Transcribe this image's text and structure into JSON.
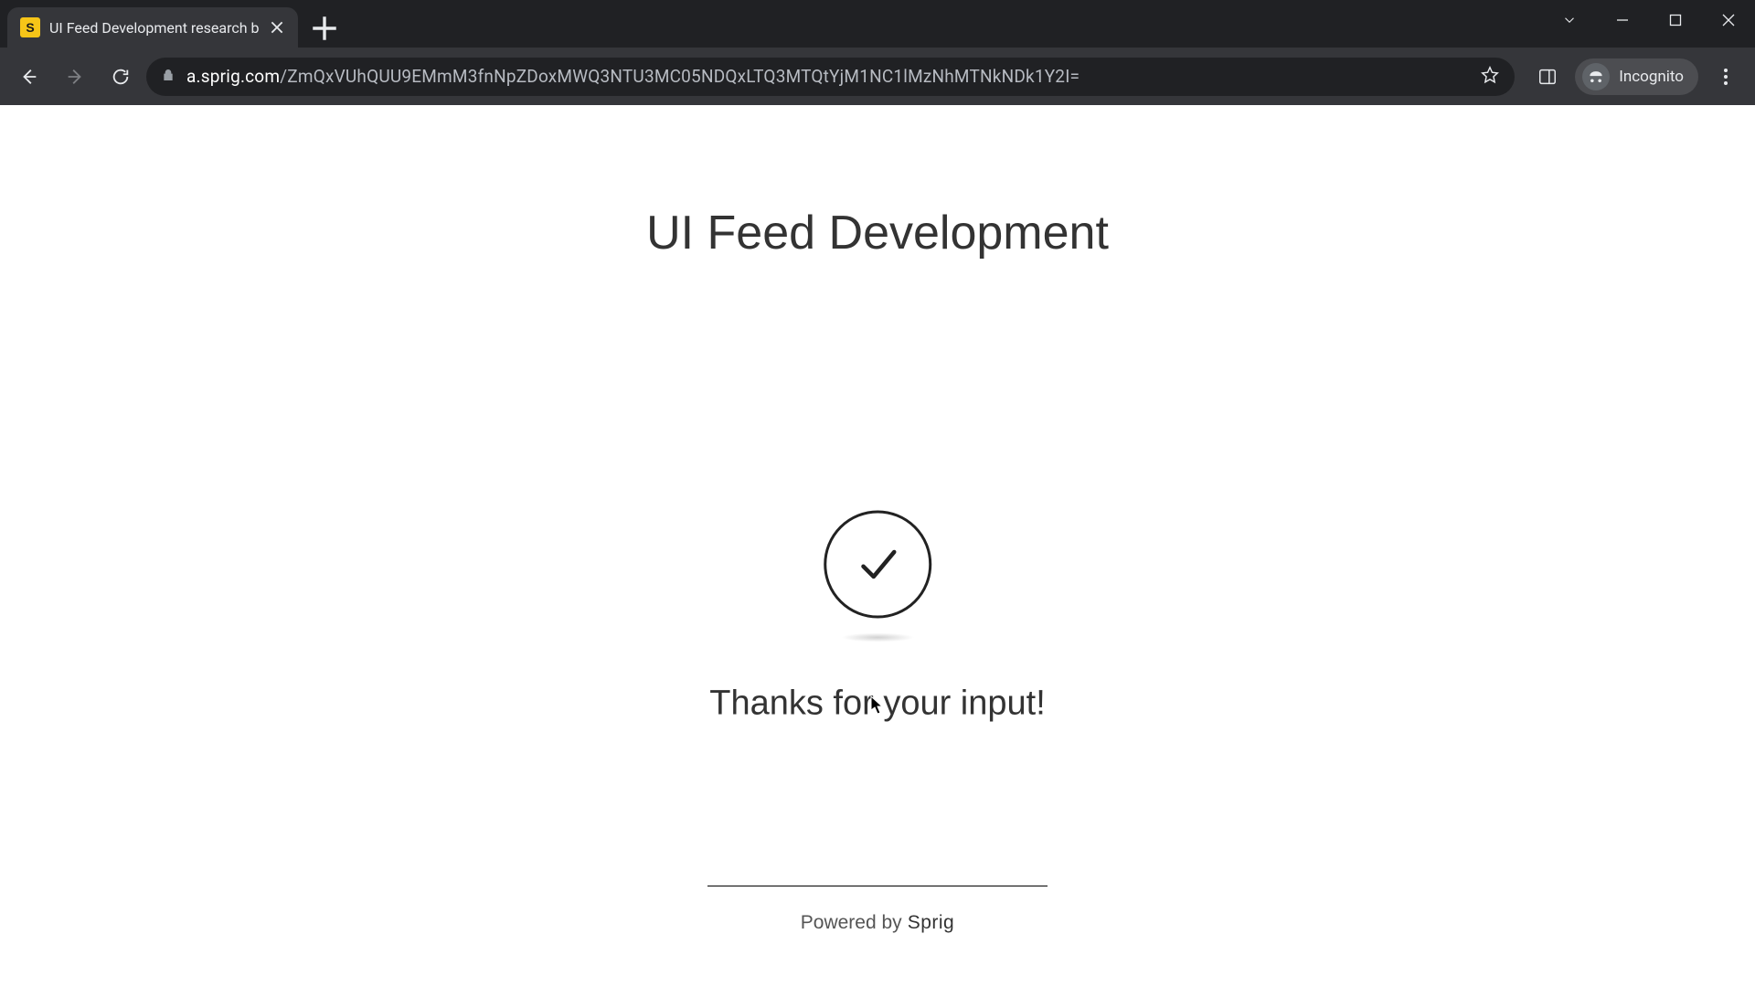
{
  "browser": {
    "tab": {
      "favicon_letter": "S",
      "title": "UI Feed Development research b"
    },
    "url_host": "a.sprig.com",
    "url_path": "/ZmQxVUhQUU9EMmM3fnNpZDoxMWQ3NTU3MC05NDQxLTQ3MTQtYjM1NC1lMzNhMTNkNDk1Y2I=",
    "incognito_label": "Incognito"
  },
  "page": {
    "title": "UI Feed Development",
    "thanks": "Thanks for your input!",
    "powered_by_prefix": "Powered by",
    "powered_by_brand": "Sprig"
  }
}
